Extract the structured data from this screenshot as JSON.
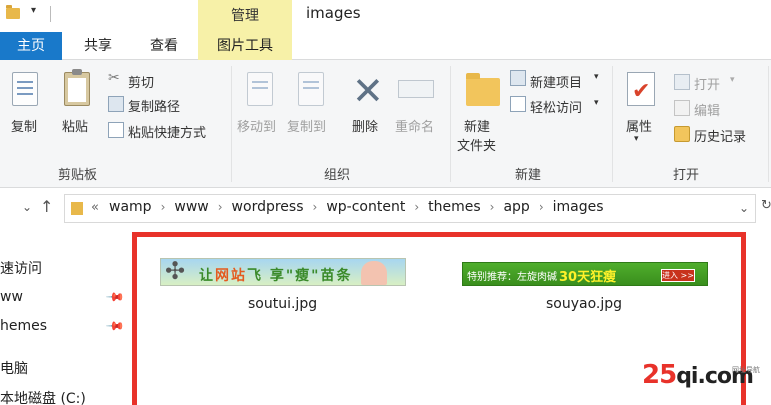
{
  "window": {
    "title": "images",
    "context_tab_group": "管理"
  },
  "tabs": [
    {
      "label": "主页",
      "active": true
    },
    {
      "label": "共享"
    },
    {
      "label": "查看"
    },
    {
      "label": "图片工具"
    }
  ],
  "ribbon": {
    "clipboard": {
      "group_label": "剪贴板",
      "copy": "复制",
      "paste": "粘贴",
      "cut": "剪切",
      "copy_path": "复制路径",
      "paste_shortcut": "粘贴快捷方式"
    },
    "organize": {
      "group_label": "组织",
      "move_to": "移动到",
      "copy_to": "复制到",
      "delete": "删除",
      "rename": "重命名"
    },
    "new": {
      "group_label": "新建",
      "new_folder_line1": "新建",
      "new_folder_line2": "文件夹",
      "new_item": "新建项目",
      "easy_access": "轻松访问"
    },
    "open": {
      "group_label": "打开",
      "properties": "属性",
      "open": "打开",
      "edit": "编辑",
      "history": "历史记录"
    }
  },
  "address": {
    "overflow": "«",
    "crumbs": [
      "wamp",
      "www",
      "wordpress",
      "wp-content",
      "themes",
      "app",
      "images"
    ]
  },
  "navpane": {
    "items": [
      {
        "label": "速访问"
      },
      {
        "label": "ww"
      },
      {
        "label": "hemes"
      },
      {
        "label": "电脑"
      },
      {
        "label": "本地磁盘 (C:)"
      }
    ]
  },
  "files": [
    {
      "name": "soutui.jpg",
      "banner_text_a": "让",
      "banner_text_b": "网站",
      "banner_text_c": "飞 享\"瘦\"苗条"
    },
    {
      "name": "souyao.jpg",
      "banner_text_a": "特别推荐：左旋肉碱",
      "banner_text_b": "30天狂瘦",
      "banner_text_c": "进入 >>"
    }
  ],
  "watermark": {
    "num": "25",
    "rest": "qi.com",
    "side": "网址导航"
  },
  "colors": {
    "home_tab": "#1979ca",
    "context_tab": "#f7f1a8",
    "highlight_frame": "#e8322a",
    "folder": "#e8b84a"
  },
  "icons": {
    "nav_up": "up-arrow-icon",
    "nav_dropdown": "chevron-down-icon",
    "pin": "pin-icon"
  }
}
